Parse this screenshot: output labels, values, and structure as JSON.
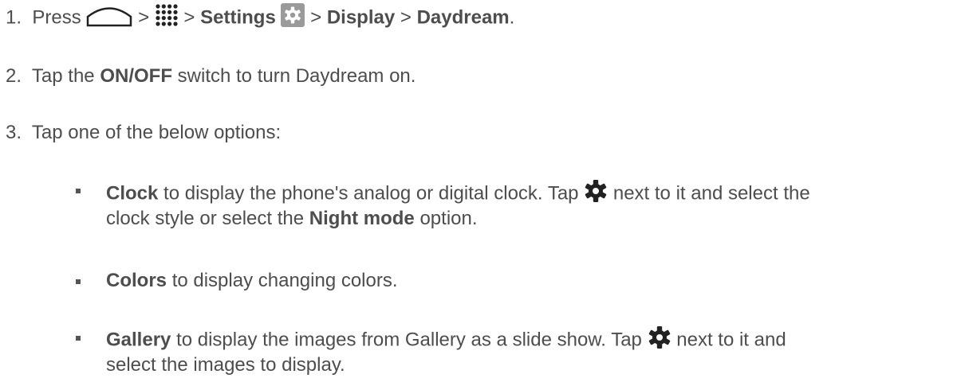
{
  "steps": [
    {
      "number": "1.",
      "press": "Press",
      "sep": ">",
      "settings": "Settings",
      "display": "Display",
      "daydream": "Daydream",
      "end": ".",
      "icons": [
        "home-icon",
        "apps-icon",
        "settings-icon"
      ]
    },
    {
      "number": "2.",
      "pre": "Tap the",
      "bold": "ON/OFF",
      "post": "switch to turn Daydream on."
    },
    {
      "number": "3.",
      "text": "Tap one of the below options:"
    }
  ],
  "options": [
    {
      "bold": "Clock",
      "text1": "to display the phone's analog or digital clock. Tap",
      "text2": "next to it and select the",
      "line2_pre": "clock style or select the",
      "line2_bold": "Night mode",
      "line2_post": "option.",
      "icon": "gear-icon"
    },
    {
      "bold": "Colors",
      "text": "to display changing colors."
    },
    {
      "bold": "Gallery",
      "text1": "to display the images from Gallery as a slide show. Tap",
      "text2": "next to it and",
      "line2": "select the images to display.",
      "icon": "gear-icon"
    }
  ],
  "colors": {
    "text": "#4d4d4d",
    "settings_icon_bg": "#9a9a9a"
  }
}
